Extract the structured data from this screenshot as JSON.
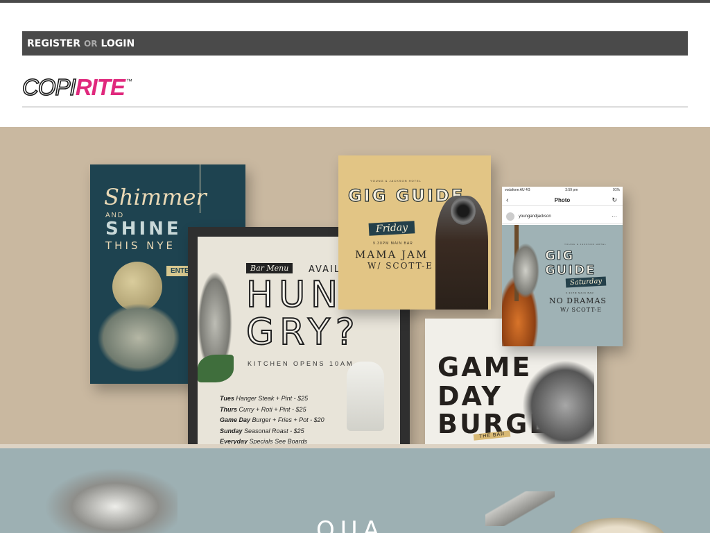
{
  "auth": {
    "register": "REGISTER",
    "or": "OR",
    "login": "LOGIN"
  },
  "logo": {
    "part1": "COPI",
    "part2": "RITE",
    "tm": "™",
    "accent_color": "#e0297d"
  },
  "colors": {
    "bar": "#4a4a4a",
    "hero_bg": "#c9b8a0",
    "bottom_bg": "#9db0b3"
  },
  "hero": {
    "shimmer": {
      "title": "Shimmer",
      "and": "AND",
      "shine": "SHINE",
      "nye": "THIS NYE",
      "tag": "ENTE"
    },
    "hungry": {
      "badge": "Bar Menu",
      "available": "AVAILAB",
      "line1": "HUN",
      "line2": "GRY?",
      "kitchen": "KITCHEN OPENS 10AM",
      "items": [
        {
          "day": "Tues",
          "text": "Hanger Steak + Pint - $25"
        },
        {
          "day": "Thurs",
          "text": "Curry + Roti + Pint - $25"
        },
        {
          "day": "Game Day",
          "text": "Burger + Fries + Pot - $20"
        },
        {
          "day": "Sunday",
          "text": "Seasonal Roast - $25"
        },
        {
          "day": "Everyday",
          "text": "Specials See Boards"
        }
      ]
    },
    "gig": {
      "venue": "YOUNG & JACKSON HOTEL",
      "title": "GIG GUIDE",
      "day": "Friday",
      "time": "9.30PM MAIN BAR",
      "act": "MAMA JAM",
      "with": "W/ SCOTT-E"
    },
    "game": {
      "line1": "GAME",
      "line2": "DAY",
      "line3": "BURGER",
      "ribbon": "THE BAR"
    },
    "phone": {
      "carrier": "vodafone AU  4G",
      "time": "3:59 pm",
      "battery": "91%",
      "nav_title": "Photo",
      "account": "youngandjackson",
      "venue": "YOUNG & JACKSON HOTEL",
      "title": "GIG GUIDE",
      "day": "Saturday",
      "time_text": "9.30PM MAIN BAR",
      "act": "NO DRAMAS",
      "with": "W/ SCOTT-E"
    }
  },
  "bottom": {
    "word": "OUA"
  }
}
